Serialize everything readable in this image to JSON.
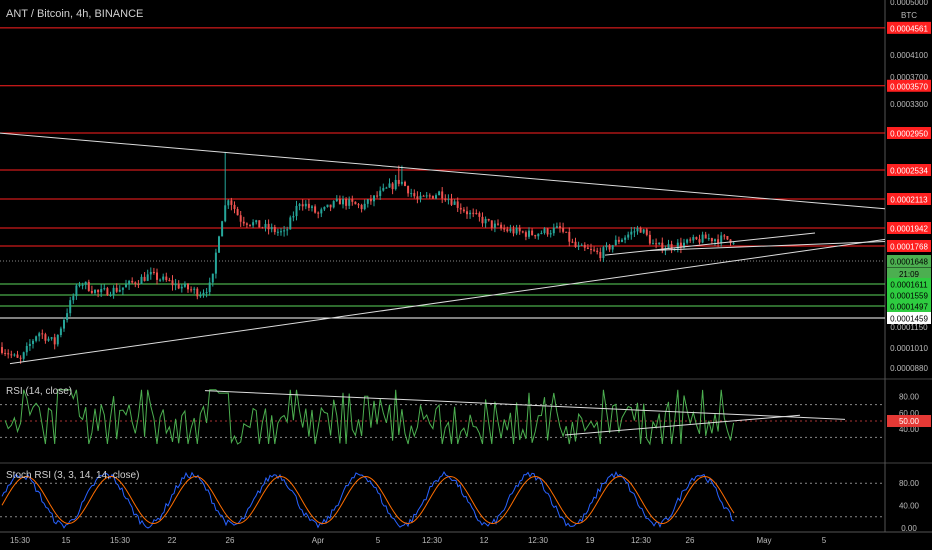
{
  "header": {
    "title": "ANT / Bitcoin, 4h, BINANCE",
    "currency": "BTC"
  },
  "colors": {
    "bg": "#000000",
    "up": "#26a69a",
    "down": "#ef5350",
    "level_red": "#ff2020",
    "level_green": "#5cd65c",
    "trend": "#dddddd",
    "rsi": "#4caf50",
    "stoch_k": "#2962ff",
    "stoch_d": "#ff6d00"
  },
  "price_axis": {
    "min": 8.2e-05,
    "max": 0.0005,
    "ticks": [
      "0.0005000",
      "0.0004100",
      "0.0003700",
      "0.0003300",
      "0.0001150",
      "0.0001010",
      "0.0000880"
    ],
    "tick_values": [
      0.0005,
      0.00041,
      0.00037,
      0.00033,
      0.000115,
      0.000101,
      8.8e-05
    ]
  },
  "levels_red": [
    {
      "label": "0.0004561",
      "value": 0.0004561
    },
    {
      "label": "0.0003570",
      "value": 0.000357
    },
    {
      "label": "0.0002950",
      "value": 0.000295
    },
    {
      "label": "0.0002534",
      "value": 0.0002534
    },
    {
      "label": "0.0002113",
      "value": 0.0002113
    },
    {
      "label": "0.0001942",
      "value": 0.0001942
    },
    {
      "label": "0.0001768",
      "value": 0.0001768
    }
  ],
  "levels_green": [
    {
      "label": "0.0001648",
      "value": 0.0001648,
      "style": "current"
    },
    {
      "label": "21:09",
      "value": 0.0001628,
      "style": "time"
    },
    {
      "label": "0.0001611",
      "value": 0.0001611,
      "style": "green"
    },
    {
      "label": "0.0001559",
      "value": 0.0001559,
      "style": "green"
    },
    {
      "label": "0.0001497",
      "value": 0.0001497,
      "style": "green"
    },
    {
      "label": "0.0001459",
      "value": 0.0001459,
      "style": "white"
    }
  ],
  "x_axis": {
    "ticks": [
      "15:30",
      "15",
      "15:30",
      "22",
      "26",
      "Apr",
      "5",
      "12:30",
      "12",
      "12:30",
      "19",
      "12:30",
      "26",
      "May",
      "5"
    ]
  },
  "rsi": {
    "title": "RSI (14, close)",
    "ticks": [
      "80.00",
      "60.00",
      "40.00"
    ],
    "tick_values": [
      80,
      60,
      40
    ],
    "current_label": "50.00",
    "current": 50
  },
  "stoch": {
    "title": "Stoch RSI (3, 3, 14, 14, close)",
    "ticks": [
      "80.00",
      "40.00",
      "0.00"
    ],
    "tick_values": [
      80,
      40,
      0
    ]
  },
  "chart_data": {
    "type": "candlestick",
    "title": "ANT / Bitcoin, 4h, BINANCE",
    "x_ticks": [
      "15:30",
      "15",
      "15:30",
      "22",
      "26",
      "Apr",
      "5",
      "12:30",
      "12",
      "12:30",
      "19",
      "12:30",
      "26",
      "May",
      "5"
    ],
    "price_key_points": [
      {
        "t": 0,
        "p": 9e-05
      },
      {
        "t": 20,
        "p": 8.3e-05
      },
      {
        "t": 38,
        "p": 9.8e-05
      },
      {
        "t": 55,
        "p": 9.2e-05
      },
      {
        "t": 80,
        "p": 0.00013
      },
      {
        "t": 98,
        "p": 0.000122
      },
      {
        "t": 120,
        "p": 0.000125
      },
      {
        "t": 150,
        "p": 0.000135
      },
      {
        "t": 175,
        "p": 0.000128
      },
      {
        "t": 200,
        "p": 0.000122
      },
      {
        "t": 212,
        "p": 0.000128
      },
      {
        "t": 220,
        "p": 0.000178
      },
      {
        "t": 228,
        "p": 0.00021
      },
      {
        "t": 240,
        "p": 0.000185
      },
      {
        "t": 260,
        "p": 0.000178
      },
      {
        "t": 285,
        "p": 0.00017
      },
      {
        "t": 300,
        "p": 0.000205
      },
      {
        "t": 318,
        "p": 0.00019
      },
      {
        "t": 340,
        "p": 0.000205
      },
      {
        "t": 362,
        "p": 0.000198
      },
      {
        "t": 380,
        "p": 0.000213
      },
      {
        "t": 400,
        "p": 0.00023
      },
      {
        "t": 418,
        "p": 0.000205
      },
      {
        "t": 440,
        "p": 0.000215
      },
      {
        "t": 470,
        "p": 0.00019
      },
      {
        "t": 500,
        "p": 0.000175
      },
      {
        "t": 530,
        "p": 0.00017
      },
      {
        "t": 560,
        "p": 0.000175
      },
      {
        "t": 575,
        "p": 0.000158
      },
      {
        "t": 600,
        "p": 0.000152
      },
      {
        "t": 620,
        "p": 0.000165
      },
      {
        "t": 640,
        "p": 0.000176
      },
      {
        "t": 655,
        "p": 0.000158
      },
      {
        "t": 680,
        "p": 0.00016
      },
      {
        "t": 705,
        "p": 0.000166
      },
      {
        "t": 735,
        "p": 0.000165
      }
    ],
    "trendlines": [
      {
        "from": [
          0,
          0.0003
        ],
        "to": [
          885,
          0.000196
        ]
      },
      {
        "from": [
          10,
          8.2e-05
        ],
        "to": [
          885,
          0.000165
        ]
      },
      {
        "from": [
          605,
          0.000151
        ],
        "to": [
          815,
          0.000171
        ]
      },
      {
        "from": [
          650,
          0.000155
        ],
        "to": [
          885,
          0.000163
        ]
      }
    ],
    "rsi_trendlines": [
      {
        "from": [
          205,
          87
        ],
        "to": [
          845,
          52
        ]
      },
      {
        "from": [
          565,
          33
        ],
        "to": [
          800,
          57
        ]
      }
    ]
  }
}
